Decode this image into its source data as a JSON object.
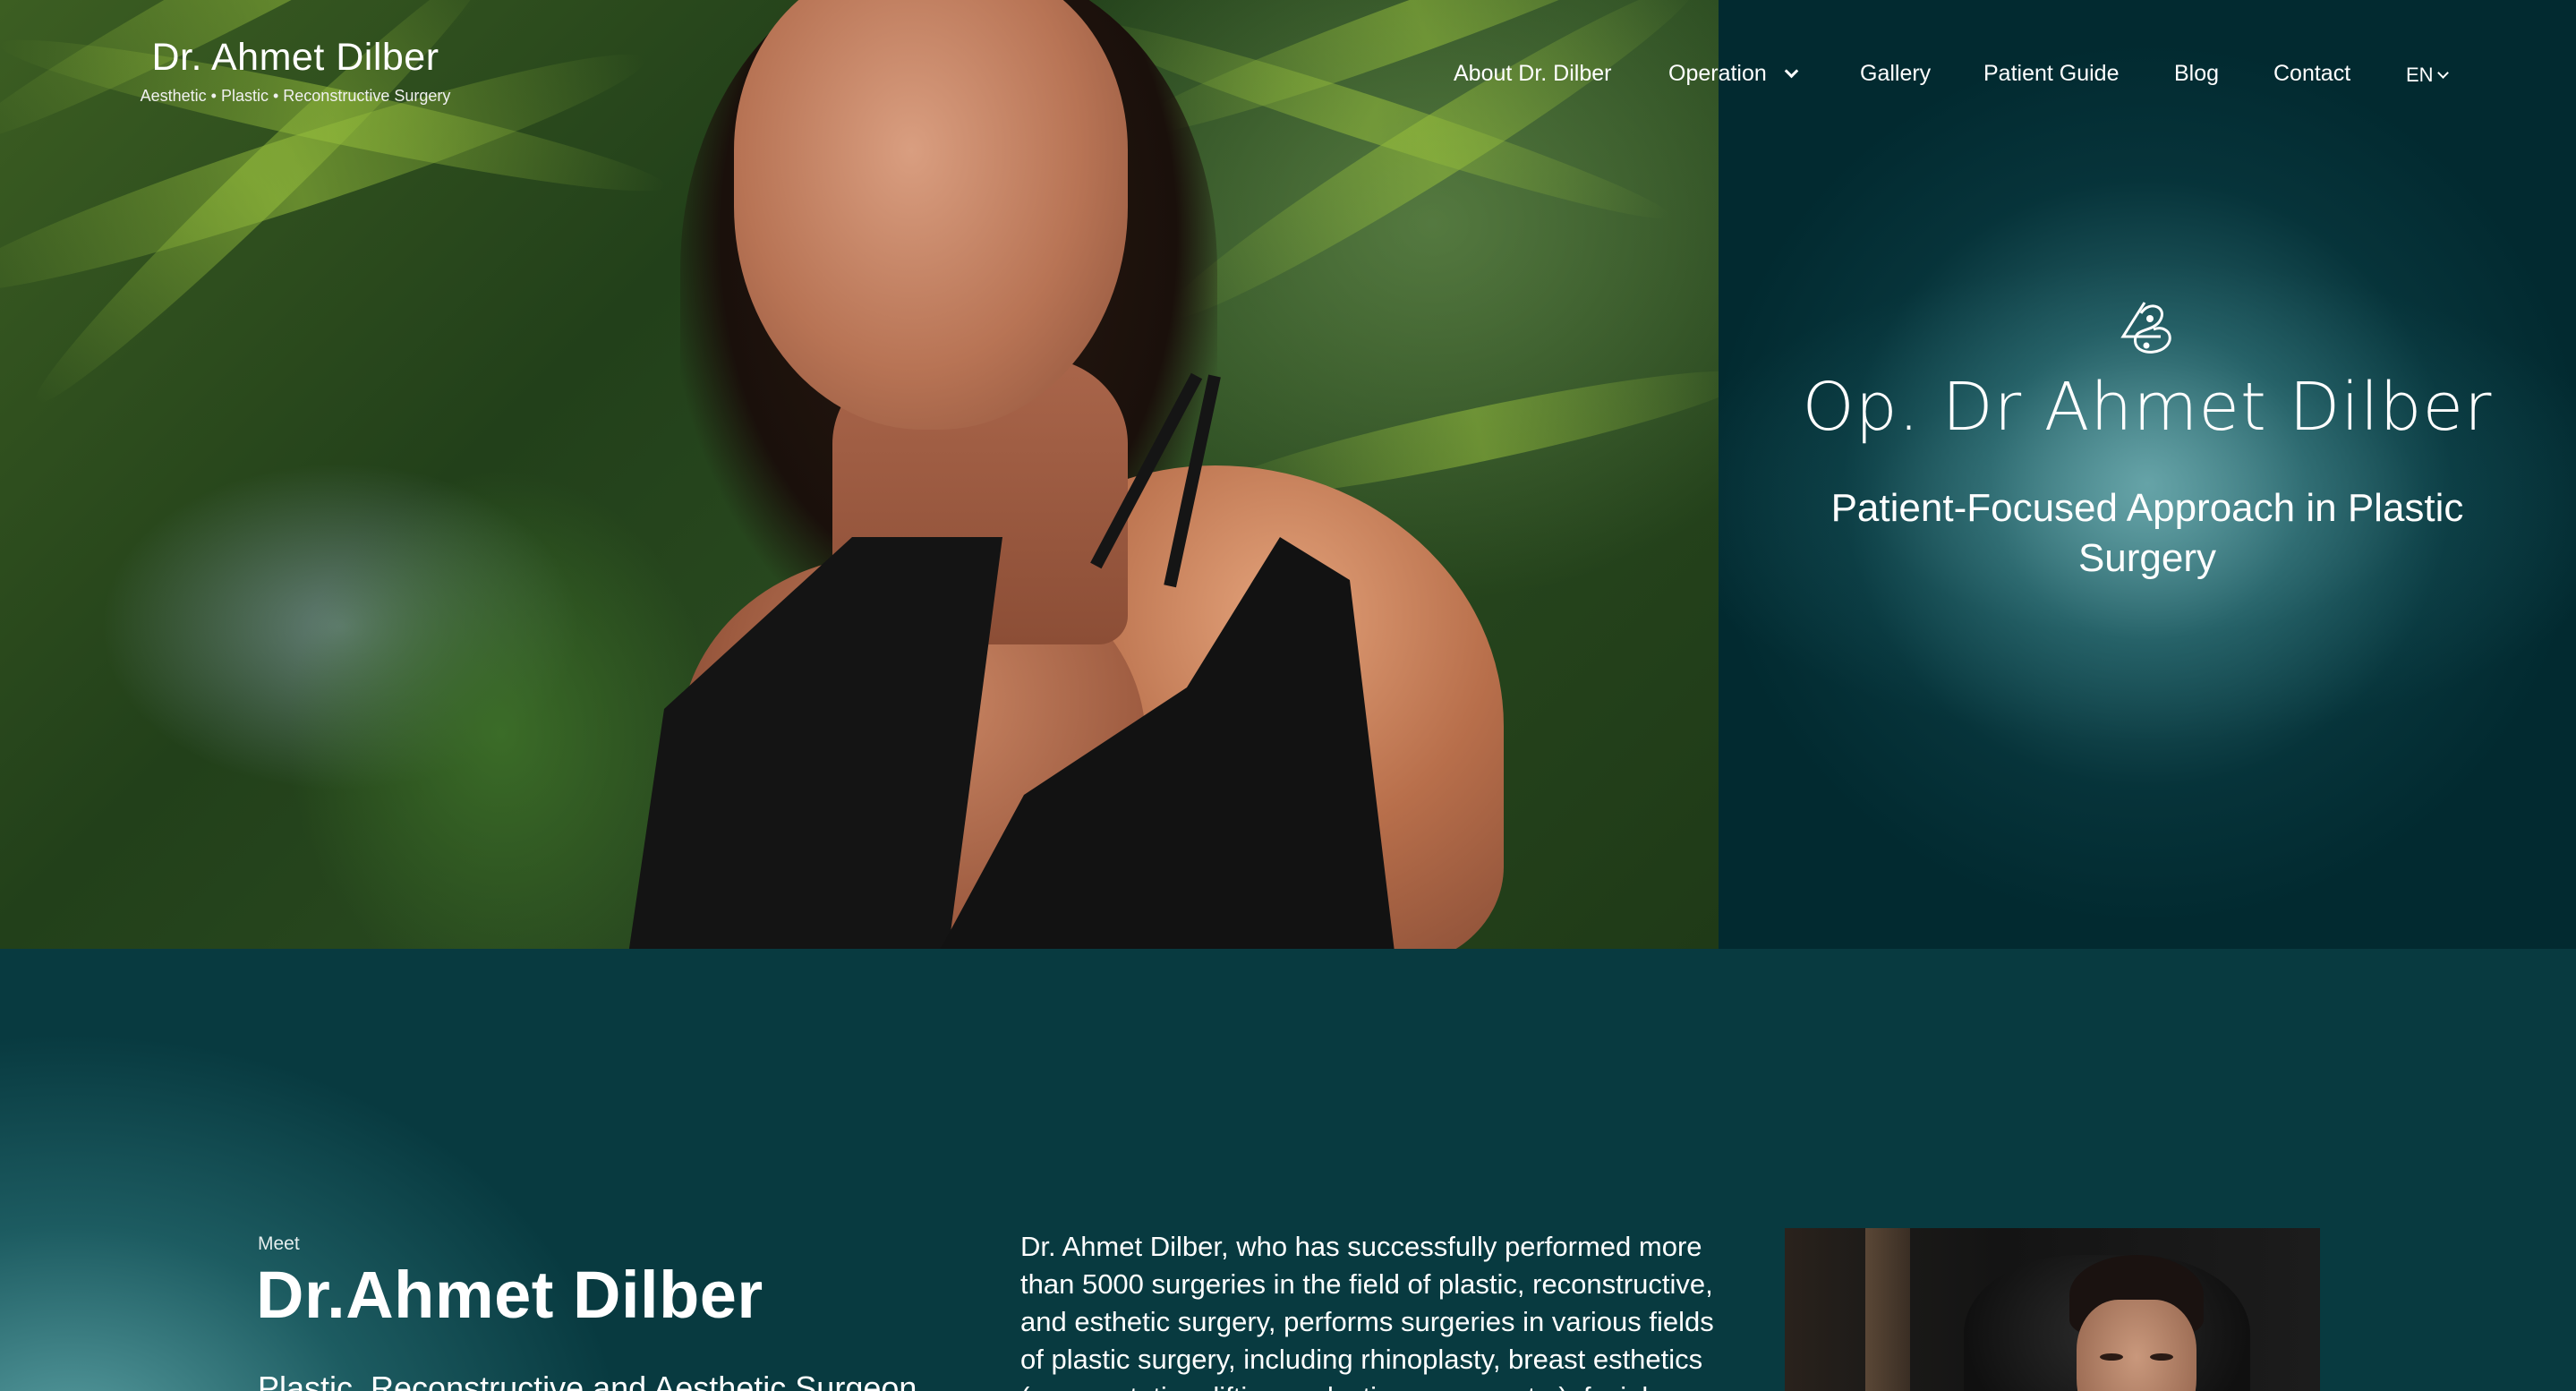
{
  "header": {
    "brand_name": "Dr. Ahmet Dilber",
    "brand_tagline": "Aesthetic • Plastic • Reconstructive Surgery",
    "nav": [
      {
        "label": "About Dr. Dilber"
      },
      {
        "label": "Operation",
        "has_dropdown": true
      },
      {
        "label": "Gallery"
      },
      {
        "label": "Patient Guide"
      },
      {
        "label": "Blog"
      },
      {
        "label": "Contact"
      }
    ],
    "language": "EN"
  },
  "hero": {
    "title": "Op. Dr Ahmet Dilber",
    "subtitle": "Patient-Focused Approach in Plastic Surgery",
    "logo_icon": "monogram-logo-icon"
  },
  "about": {
    "meet": "Meet",
    "name": "Dr.Ahmet Dilber",
    "role": "Plastic, Reconstructive and Aesthetic Surgeon",
    "description": "Dr. Ahmet Dilber, who has successfully performed more than 5000 surgeries in the field of plastic, reconstructive, and esthetic surgery, performs surgeries in various fields of plastic surgery, including rhinoplasty, breast esthetics (augmentation, lifting, reduction, asymmetry), facial"
  },
  "colors": {
    "panel_bg": "#022a30",
    "section_bg": "#083a40",
    "glow": "#6dacb0"
  }
}
